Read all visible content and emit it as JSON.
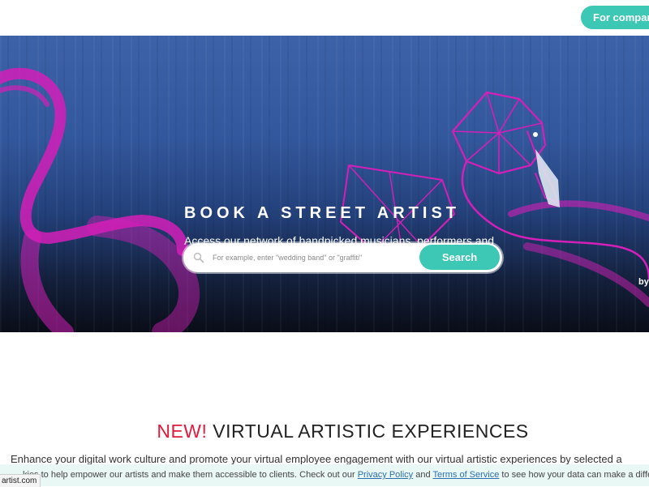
{
  "header": {
    "cta_label": "For companies"
  },
  "hero": {
    "title": "BOOK A STREET ARTIST",
    "subtitle": "Access our network of handpicked musicians, performers and visual artists.",
    "search": {
      "placeholder": "For example, enter \"wedding band\" or \"graffiti\"",
      "value": ""
    },
    "search_button": "Search",
    "credit": "by"
  },
  "section": {
    "title_highlight": "NEW!",
    "title_rest": " VIRTUAL ARTISTIC EXPERIENCES",
    "description": "Enhance your digital work culture and promote your virtual employee engagement with our virtual artistic experiences by selected a"
  },
  "cookie": {
    "text_before": "kies to help empower our artists and make them accessible to clients. Check out our ",
    "privacy_link": "Privacy Policy",
    "text_and": " and ",
    "terms_link": "Terms of Service",
    "text_after": " to see how your data can make a differenc"
  },
  "status_url": "artist.com",
  "colors": {
    "accent": "#3cc8b4",
    "new_red": "#e21b3c",
    "flamingo": "#d41fb8"
  }
}
